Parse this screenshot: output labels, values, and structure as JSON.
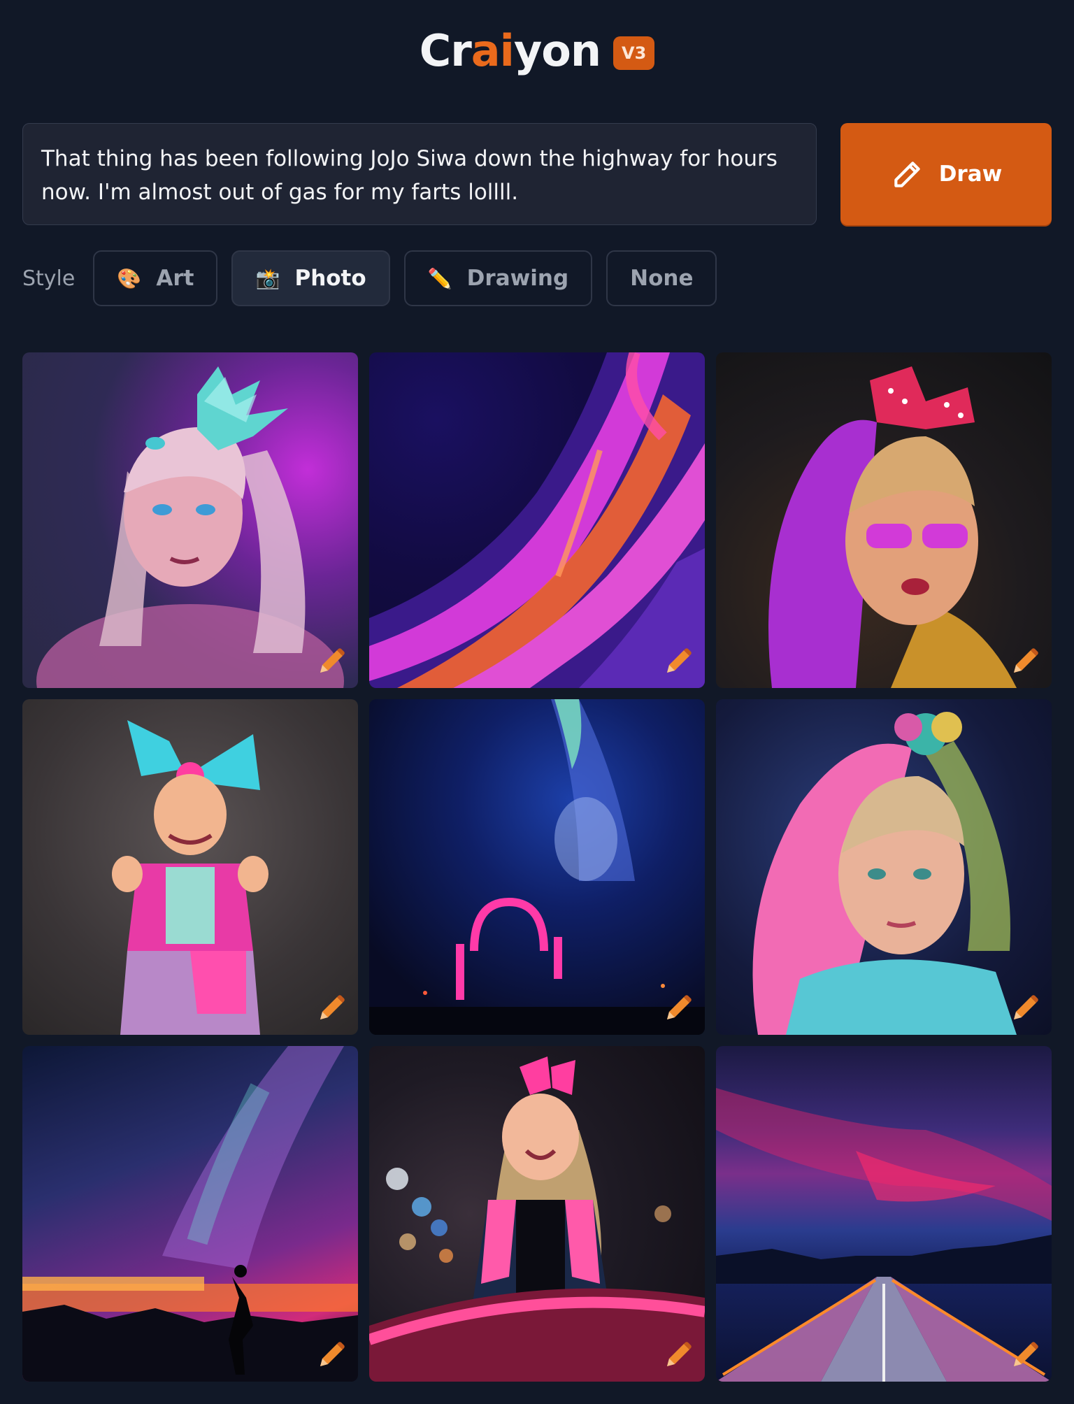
{
  "header": {
    "logo_part1": "Cr",
    "logo_part2": "ai",
    "logo_part3": "yon",
    "version_badge": "V3"
  },
  "prompt": {
    "text": "That thing has been following JoJo Siwa down the highway for hours now. I'm almost out of gas for my farts lollll."
  },
  "draw_button": {
    "label": "Draw",
    "icon": "pencil-icon"
  },
  "style": {
    "label": "Style",
    "options": [
      {
        "label": "Art",
        "icon": "palette-icon",
        "glyph": "🎨",
        "active": false
      },
      {
        "label": "Photo",
        "icon": "camera-icon",
        "glyph": "📸",
        "active": true
      },
      {
        "label": "Drawing",
        "icon": "pencil-icon",
        "glyph": "✏️",
        "active": false
      },
      {
        "label": "None",
        "icon": "",
        "glyph": "",
        "active": false
      }
    ]
  },
  "results": {
    "count": 9,
    "edit_icon": "pencil-icon",
    "accent_color": "#d45a13"
  },
  "colors": {
    "background": "#111827",
    "accent": "#d45a13",
    "prompt_bg": "#1f2433"
  }
}
